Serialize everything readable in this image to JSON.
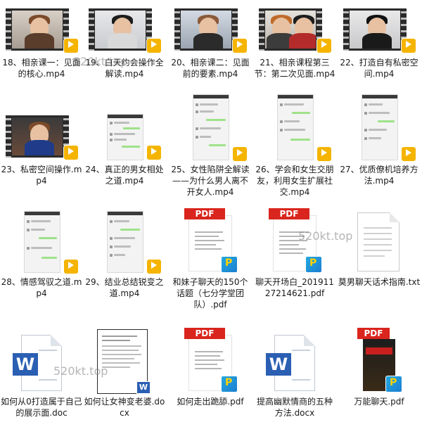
{
  "files": [
    {
      "id": "f18",
      "label": "18、相亲课一：见面的核心.mp4",
      "type": "video"
    },
    {
      "id": "f19",
      "label": "19、白天约会操作全解读.mp4",
      "type": "video"
    },
    {
      "id": "f20",
      "label": "20、相亲课二：见面前的要素.mp4",
      "type": "video"
    },
    {
      "id": "f21",
      "label": "21、相亲课程第三节：第二次见面.mp4",
      "type": "video"
    },
    {
      "id": "f22",
      "label": "22、打造自有私密空间.mp4",
      "type": "video"
    },
    {
      "id": "f23",
      "label": "23、私密空间操作.mp4",
      "type": "video"
    },
    {
      "id": "f24",
      "label": "24、真正的男女相处之道.mp4",
      "type": "chat-video"
    },
    {
      "id": "f25",
      "label": "25、女性陷阱全解读——为什么男人离不开女人.mp4",
      "type": "chat-video"
    },
    {
      "id": "f26",
      "label": "26、学会和女生交朋友，利用女生扩展社交.mp4",
      "type": "chat-video"
    },
    {
      "id": "f27",
      "label": "27、优质僚机培养方法.mp4",
      "type": "chat-video"
    },
    {
      "id": "f28",
      "label": "28、情感驾驭之道.mp4",
      "type": "chat-video"
    },
    {
      "id": "f29",
      "label": "29、结业总结锐变之道.mp4",
      "type": "chat-video"
    },
    {
      "id": "f30",
      "label": "和妹子聊天的150个话题（七分学堂团队）.pdf",
      "type": "pdf"
    },
    {
      "id": "f31",
      "label": "聊天开场白_20191127214621.pdf",
      "type": "pdf"
    },
    {
      "id": "f32",
      "label": "莫男聊天话术指南.txt",
      "type": "txt"
    },
    {
      "id": "f33",
      "label": "如何从0打造属于自己的展示面.doc",
      "type": "word"
    },
    {
      "id": "f34",
      "label": "如何让女神变老婆.docx",
      "type": "word-doc"
    },
    {
      "id": "f35",
      "label": "如何走出跪舔.pdf",
      "type": "pdf"
    },
    {
      "id": "f36",
      "label": "提高幽默情商的五种方法.docx",
      "type": "word"
    },
    {
      "id": "f37",
      "label": "万能聊天.pdf",
      "type": "pdf-book"
    }
  ],
  "icons": {
    "pdf_tag": "PDF",
    "word_letter": "W",
    "player_badge": "PotPlayer"
  },
  "watermarks": [
    "520kt.top",
    "520kt.top",
    "520kt.top"
  ],
  "colors": {
    "pdf_red": "#d9251d",
    "word_blue": "#2b5fb3",
    "badge_yellow": "#f5b400"
  }
}
